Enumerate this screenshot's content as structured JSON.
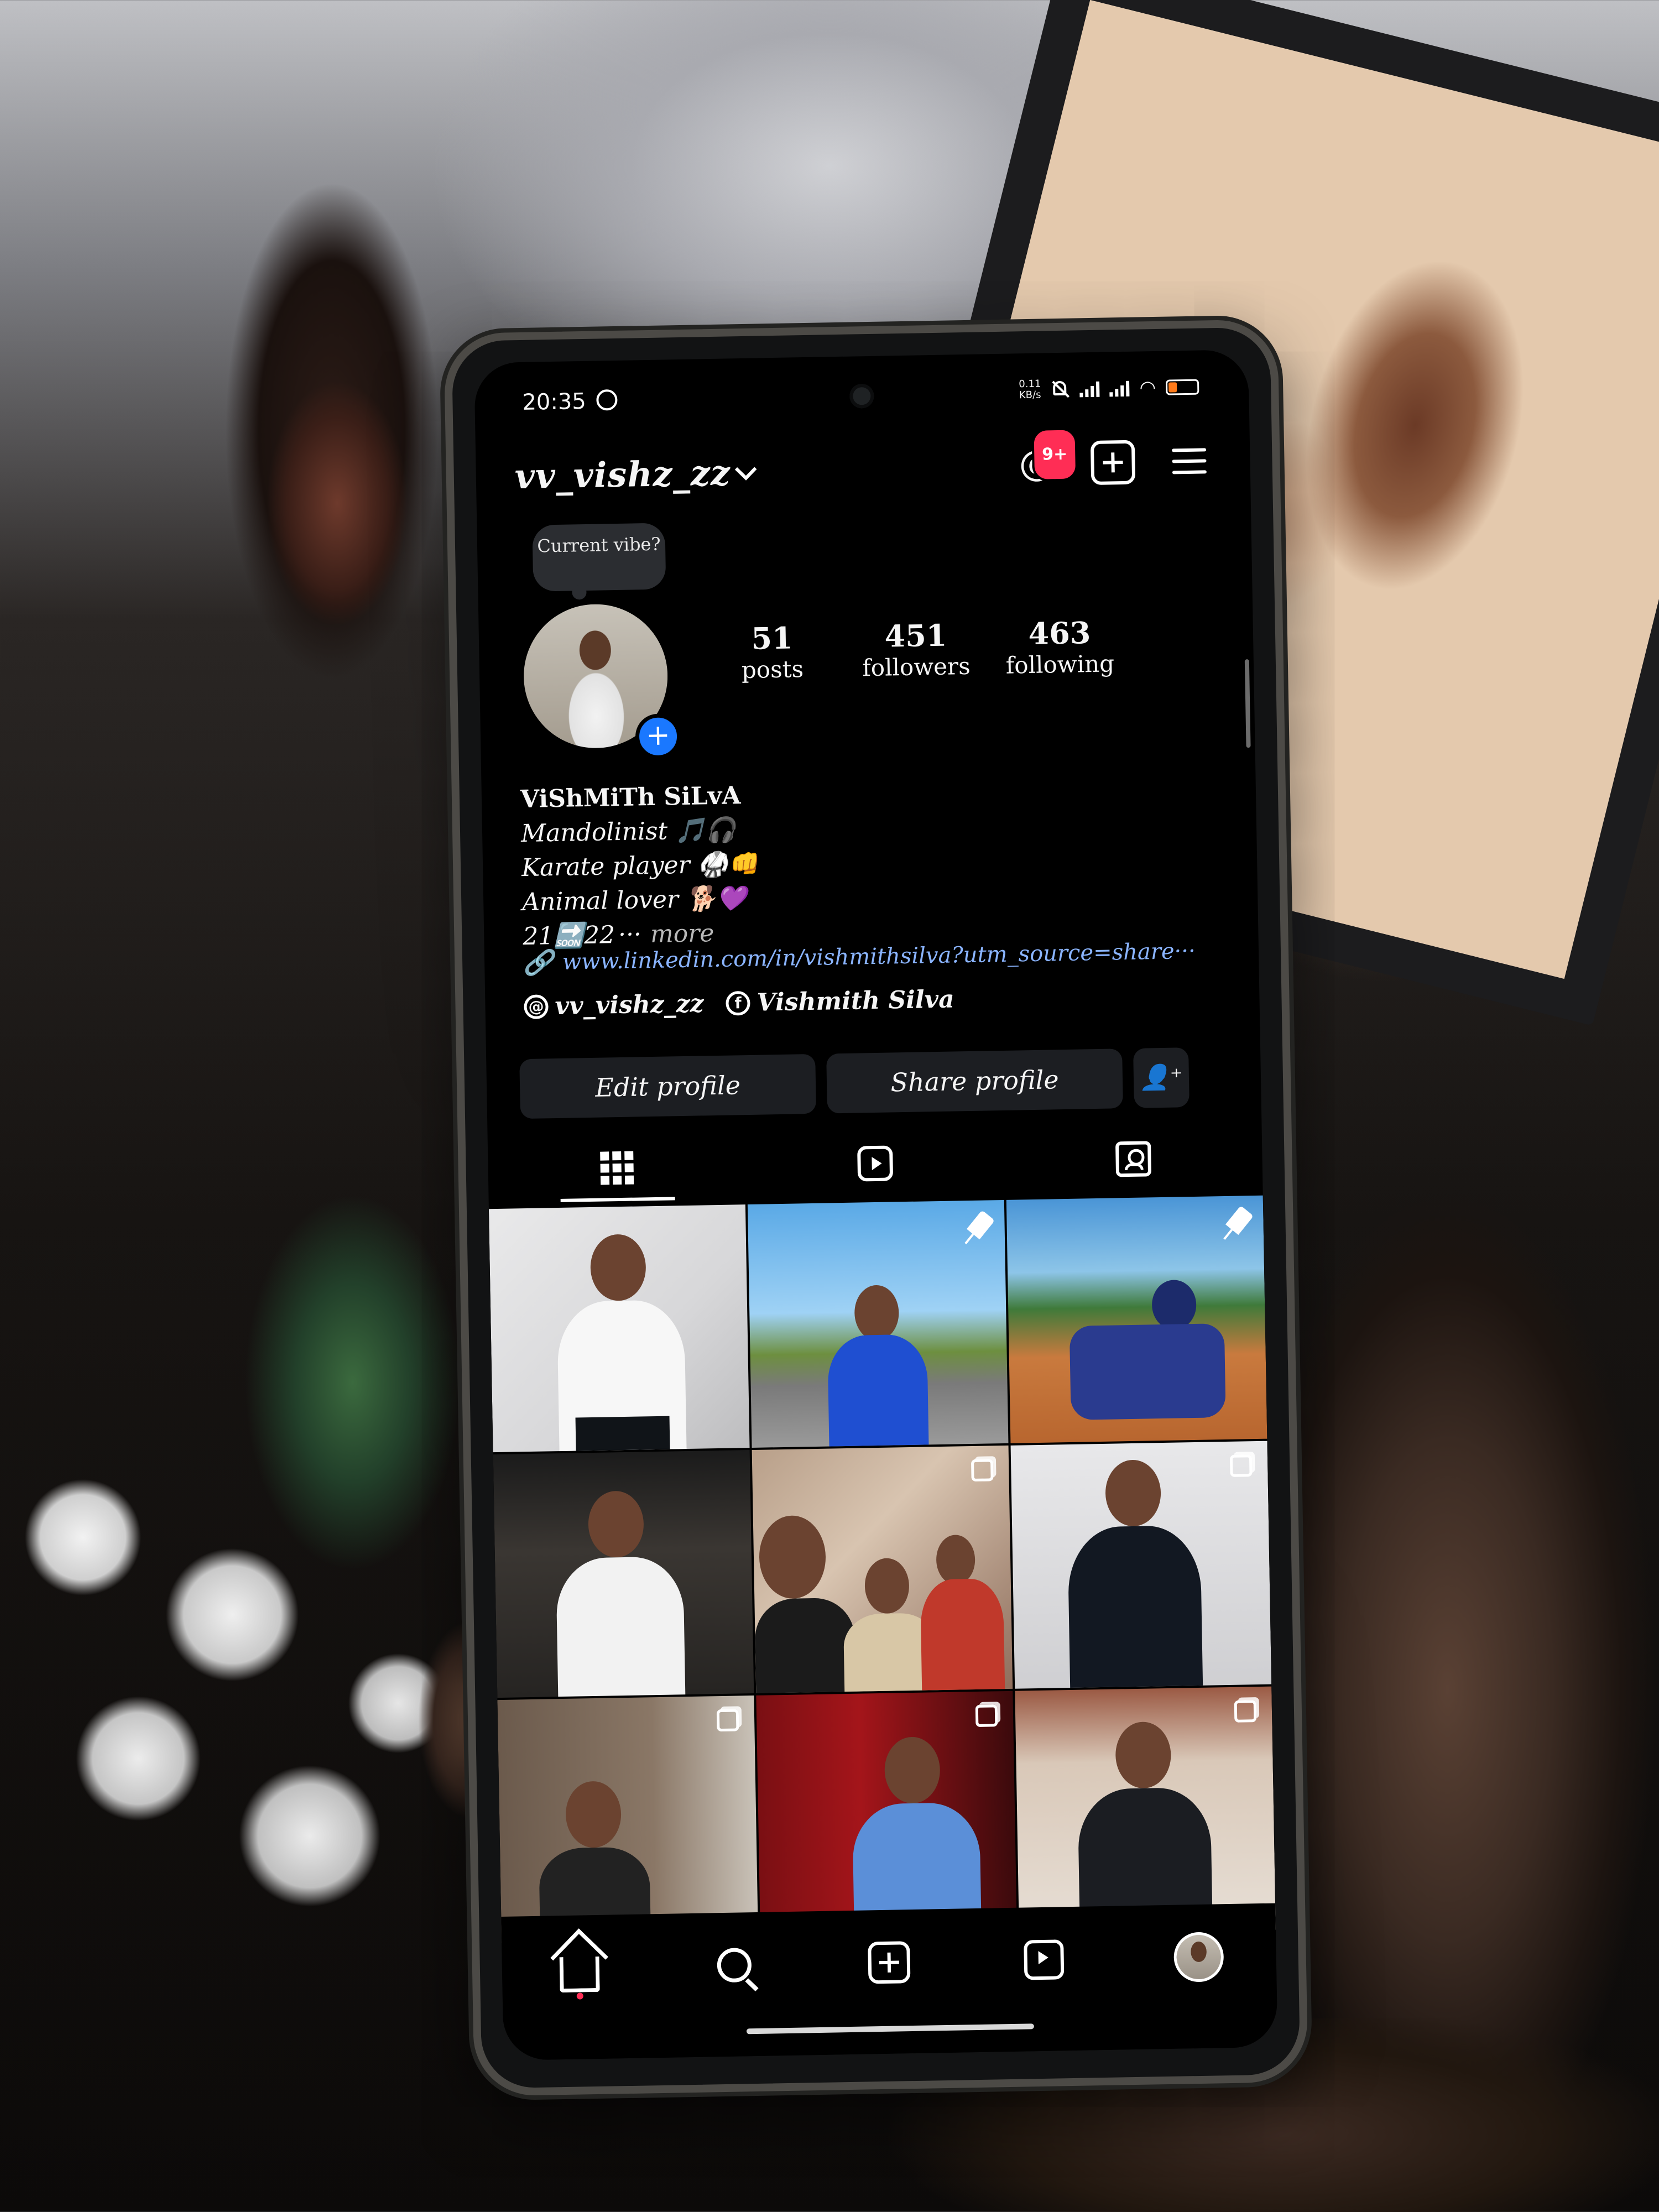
{
  "status_bar": {
    "time": "20:35",
    "net_speed": "0.11\nKB/s",
    "battery": "27"
  },
  "header": {
    "username": "vv_vishz_zz",
    "notif_badge": "9+"
  },
  "profile": {
    "note": "Current vibe?",
    "stats": [
      {
        "num": "51",
        "label": "posts"
      },
      {
        "num": "451",
        "label": "followers"
      },
      {
        "num": "463",
        "label": "following"
      }
    ],
    "bio": {
      "name": "ViShMiTh SiLvA",
      "line1": "Mandolinist 🎵🎧",
      "line2": "Karate player 🥋👊",
      "line3": "Animal lover 🐕💜",
      "line4": "21🔜22",
      "more": "more"
    },
    "link": "www.linkedin.com/in/vishmithsilva?utm_source=share···",
    "threads_handle": "vv_vishz_zz",
    "facebook_name": "Vishmith Silva"
  },
  "actions": {
    "edit": "Edit profile",
    "share": "Share profile"
  },
  "icons": {
    "threads": "threads-icon",
    "new_post": "plus-square-icon",
    "menu": "hamburger-menu-icon",
    "link": "link-icon",
    "grid": "grid-icon",
    "reels": "reels-icon",
    "tagged": "tagged-icon",
    "home": "home-icon",
    "search": "search-icon",
    "profile": "avatar"
  },
  "colors": {
    "badge": "#ff2d55",
    "link": "#8ab4ff",
    "add_story": "#1a78ff",
    "button_bg": "#1c1e22"
  }
}
